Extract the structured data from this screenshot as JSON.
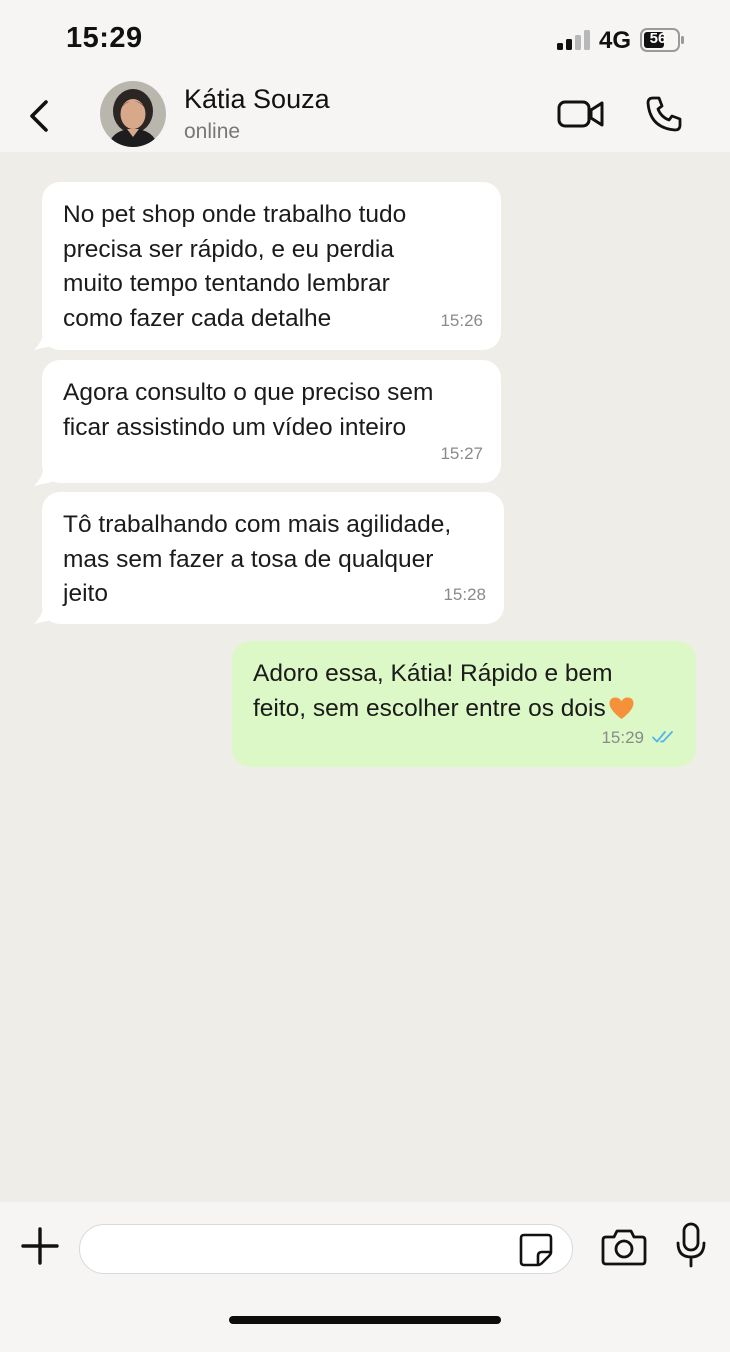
{
  "status_bar": {
    "time": "15:29",
    "network": "4G",
    "battery_level": "56",
    "signal_icon": "cellular-signal-icon",
    "battery_icon": "battery-icon"
  },
  "header": {
    "contact_name": "Kátia Souza",
    "contact_status": "online",
    "back_icon": "chevron-left-icon",
    "video_icon": "video-camera-icon",
    "phone_icon": "phone-icon"
  },
  "messages": [
    {
      "direction": "in",
      "text": "No pet shop onde trabalho tudo\nprecisa ser rápido, e eu perdia\nmuito tempo tentando lembrar\ncomo fazer cada detalhe",
      "time": "15:26"
    },
    {
      "direction": "in",
      "text": "Agora consulto o que preciso sem\nficar assistindo um vídeo inteiro",
      "time": "15:27"
    },
    {
      "direction": "in",
      "text": "Tô trabalhando com mais agilidade,\nmas sem fazer a tosa de qualquer\njeito",
      "time": "15:28"
    },
    {
      "direction": "out",
      "text": "Adoro essa, Kátia! Rápido e bem\nfeito, sem escolher entre os dois",
      "emoji": "orange-heart-icon",
      "time": "15:29",
      "read_status": "double-check-read-icon"
    }
  ],
  "input_bar": {
    "placeholder": "",
    "value": "",
    "icons": [
      "plus-icon",
      "sticker-icon",
      "camera-icon",
      "microphone-icon"
    ]
  },
  "colors": {
    "incoming_bubble": "#ffffff",
    "outgoing_bubble": "#dcf8c6",
    "read_ticks": "#4fb6ec",
    "heart": "#f4913a",
    "chat_background": "#efede8"
  }
}
